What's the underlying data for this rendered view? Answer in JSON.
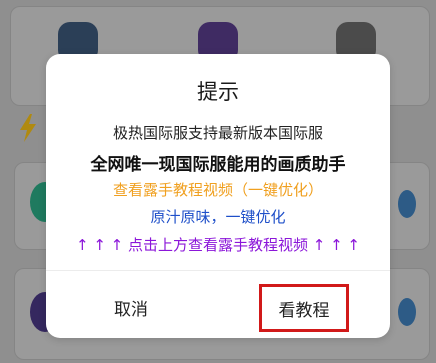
{
  "dialog": {
    "title": "提示",
    "line1": "极热国际服支持最新版本国际服",
    "line2": "全网唯一现国际服能用的画质助手",
    "line3": "查看露手教程视频（一键优化）",
    "line4": "原汁原味，一键优化",
    "line5": "↑ ↑ ↑ 点击上方查看露手教程视频 ↑ ↑ ↑",
    "cancel_label": "取消",
    "view_label": "看教程"
  },
  "colors": {
    "overlay": "#8f8f8f",
    "line3": "#f0a020",
    "line4": "#1e4fc9",
    "line5": "#8b16d9",
    "highlight_border": "#d11919"
  },
  "icons": {
    "background_apps": [
      "app-icon",
      "app-icon",
      "app-icon"
    ],
    "background_section": "lightning-icon"
  }
}
